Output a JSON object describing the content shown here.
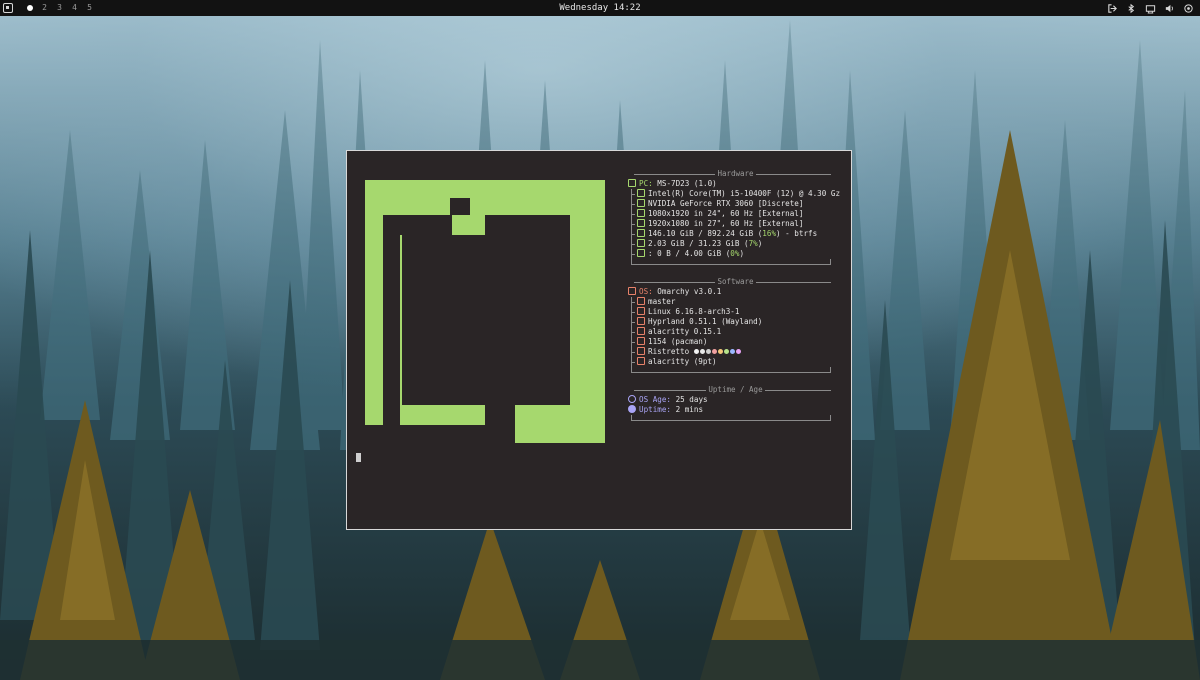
{
  "topbar": {
    "workspaces": [
      "2",
      "3",
      "4",
      "5"
    ],
    "clock": "Wednesday 14:22"
  },
  "terminal": {
    "hardware": {
      "title": "Hardware",
      "pc": {
        "key": "PC:",
        "value": "MS-7D23 (1.0)"
      },
      "items": [
        "Intel(R) Core(TM) i5-10400F (12) @ 4.30 Gz",
        "NVIDIA GeForce RTX 3060 [Discrete]",
        "1080x1920 in 24\", 60 Hz [External]",
        "1920x1080 in 27\", 60 Hz [External]"
      ],
      "disk": {
        "pre": "146.10 GiB / 892.24 GiB (",
        "pct": "16%",
        "post": ") - btrfs"
      },
      "mem": {
        "pre": "2.03 GiB / 31.23 GiB (",
        "pct": "7%",
        "post": ")"
      },
      "swap": {
        "pre": ": 0 B / 4.00 GiB (",
        "pct": "0%",
        "post": ")"
      }
    },
    "software": {
      "title": "Software",
      "os": {
        "key": "OS:",
        "value": "Omarchy v3.0.1"
      },
      "items": [
        "master",
        "Linux 6.16.8-arch3-1",
        "Hyprland 0.51.1 (Wayland)",
        "alacritty 0.15.1",
        "1154 (pacman)"
      ],
      "font": "Ristretto",
      "terminal_font": "alacritty (9pt)",
      "palette": [
        "#f2f2f2",
        "#e8e8e8",
        "#d0d0d0",
        "#f0a0a0",
        "#f4c77a",
        "#b7e38a",
        "#9ab8ff",
        "#e6a3f5"
      ]
    },
    "uptime": {
      "title": "Uptime / Age",
      "os_age": {
        "key": "OS Age:",
        "value": "25 days"
      },
      "uptime": {
        "key": "Uptime:",
        "value": "2 mins"
      }
    }
  },
  "colors": {
    "logo": "#a6d86e",
    "terminal_bg": "#2a2526",
    "hardware_accent": "#a6d86e",
    "software_accent": "#e8826a",
    "uptime_accent": "#a9a4f5"
  }
}
